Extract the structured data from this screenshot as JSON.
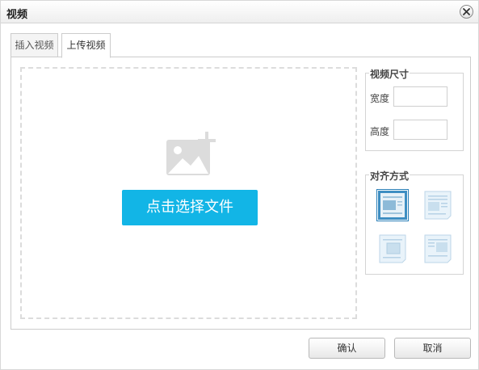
{
  "dialog": {
    "title": "视频"
  },
  "tabs": [
    {
      "label": "插入视频"
    },
    {
      "label": "上传视频"
    }
  ],
  "upload": {
    "pick_button": "点击选择文件"
  },
  "size": {
    "legend": "视频尺寸",
    "width_label": "宽度",
    "width_value": "",
    "height_label": "高度",
    "height_value": ""
  },
  "align": {
    "legend": "对齐方式",
    "options": [
      "none",
      "left",
      "right",
      "center"
    ],
    "selected": "none"
  },
  "footer": {
    "ok_label": "确认",
    "cancel_label": "取消"
  },
  "colors": {
    "accent": "#12b5e6",
    "selected_outline": "#2a7fb8"
  }
}
